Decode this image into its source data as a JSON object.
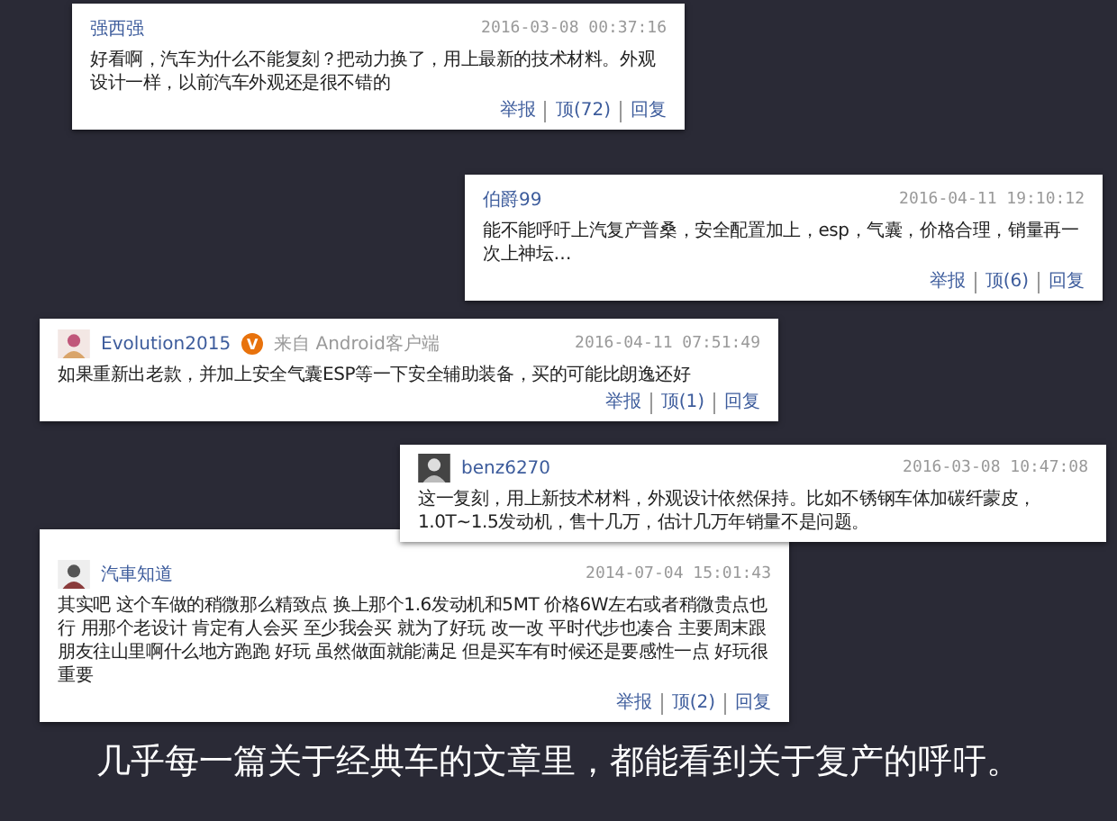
{
  "comments": [
    {
      "kind": "plain",
      "user": "强西强",
      "date": "2016-03-08 00:37:16",
      "text": "好看啊，汽车为什么不能复刻？把动力换了，用上最新的技术材料。外观设计一样，以前汽车外观还是很不错的",
      "actions": [
        "举报",
        "顶(72)",
        "回复"
      ]
    },
    {
      "kind": "plain",
      "user": "伯爵99",
      "date": "2016-04-11 19:10:12",
      "text": "能不能呼吁上汽复产普桑，安全配置加上，esp，气囊，价格合理，销量再一次上神坛…",
      "actions": [
        "举报",
        "顶(6)",
        "回复"
      ]
    },
    {
      "kind": "avatar",
      "user": "Evolution2015",
      "badge": "V",
      "source": "来自 Android客户端",
      "date": "2016-04-11 07:51:49",
      "text": "如果重新出老款，并加上安全气囊ESP等一下安全辅助装备，买的可能比朗逸还好",
      "actions": [
        "举报",
        "顶(1)",
        "回复"
      ]
    },
    {
      "kind": "avatar",
      "user": "benz6270",
      "date": "2016-03-08 10:47:08",
      "text": "这一复刻，用上新技术材料，外观设计依然保持。比如不锈钢车体加碳纤蒙皮，1.0T~1.5发动机，售十几万，估计几万年销量不是问题。"
    },
    {
      "kind": "avatar",
      "user": "汽車知道",
      "date": "2014-07-04 15:01:43",
      "text": "其实吧 这个车做的稍微那么精致点 换上那个1.6发动机和5MT 价格6W左右或者稍微贵点也行 用那个老设计 肯定有人会买 至少我会买 就为了好玩 改一改 平时代步也凑合 主要周末跟朋友往山里啊什么地方跑跑 好玩 虽然做面就能满足 但是买车有时候还是要感性一点 好玩很重要",
      "actions": [
        "举报",
        "顶(2)",
        "回复"
      ]
    }
  ],
  "caption": "几乎每一篇关于经典车的文章里，都能看到关于复产的呼吁。"
}
